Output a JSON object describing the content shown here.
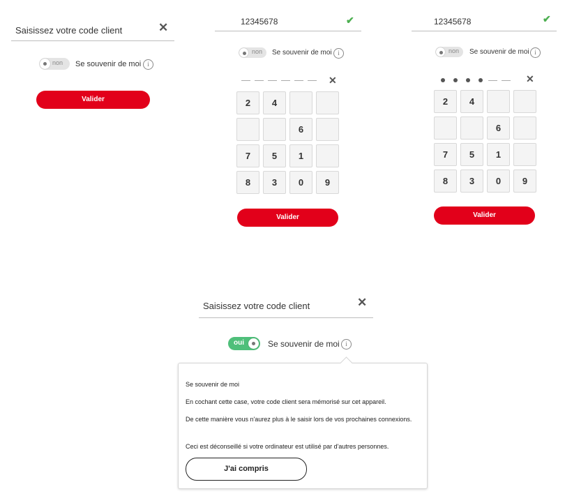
{
  "panel1": {
    "placeholder": "Saisissez votre code client",
    "close_icon": "close-icon",
    "toggle_label": "non",
    "remember_label": "Se souvenir de moi",
    "info_glyph": "i",
    "submit_label": "Valider"
  },
  "panel2": {
    "code_value": "12345678",
    "check_icon": "checkmark-icon",
    "toggle_label": "non",
    "remember_label": "Se souvenir de moi",
    "info_glyph": "i",
    "pin_entered": 0,
    "pin_length": 6,
    "clear_glyph": "✕",
    "keys": [
      "2",
      "4",
      "",
      "",
      "",
      "",
      "6",
      "",
      "7",
      "5",
      "1",
      "",
      "8",
      "3",
      "0",
      "9"
    ],
    "submit_label": "Valider"
  },
  "panel3": {
    "code_value": "12345678",
    "check_icon": "checkmark-icon",
    "toggle_label": "non",
    "remember_label": "Se souvenir de moi",
    "info_glyph": "i",
    "pin_entered": 4,
    "pin_length": 6,
    "clear_glyph": "✕",
    "keys": [
      "2",
      "4",
      "",
      "",
      "",
      "",
      "6",
      "",
      "7",
      "5",
      "1",
      "",
      "8",
      "3",
      "0",
      "9"
    ],
    "submit_label": "Valider"
  },
  "panel4": {
    "placeholder": "Saisissez votre code client",
    "close_glyph": "✕",
    "toggle_label": "oui",
    "remember_label": "Se souvenir de moi",
    "info_glyph": "i",
    "tooltip": {
      "title": "Se souvenir de moi",
      "line1": "En cochant cette case, votre code client sera mémorisé sur cet appareil.",
      "line2": "De cette manière vous n'aurez plus à le saisir lors de vos prochaines connexions.",
      "line3": "Ceci est déconseillé si votre ordinateur est utilisé par d'autres personnes.",
      "button_label": "J'ai compris"
    }
  },
  "colors": {
    "accent_red": "#e2001a",
    "toggle_on_green": "#4fbf7a",
    "check_green": "#4caf50"
  }
}
